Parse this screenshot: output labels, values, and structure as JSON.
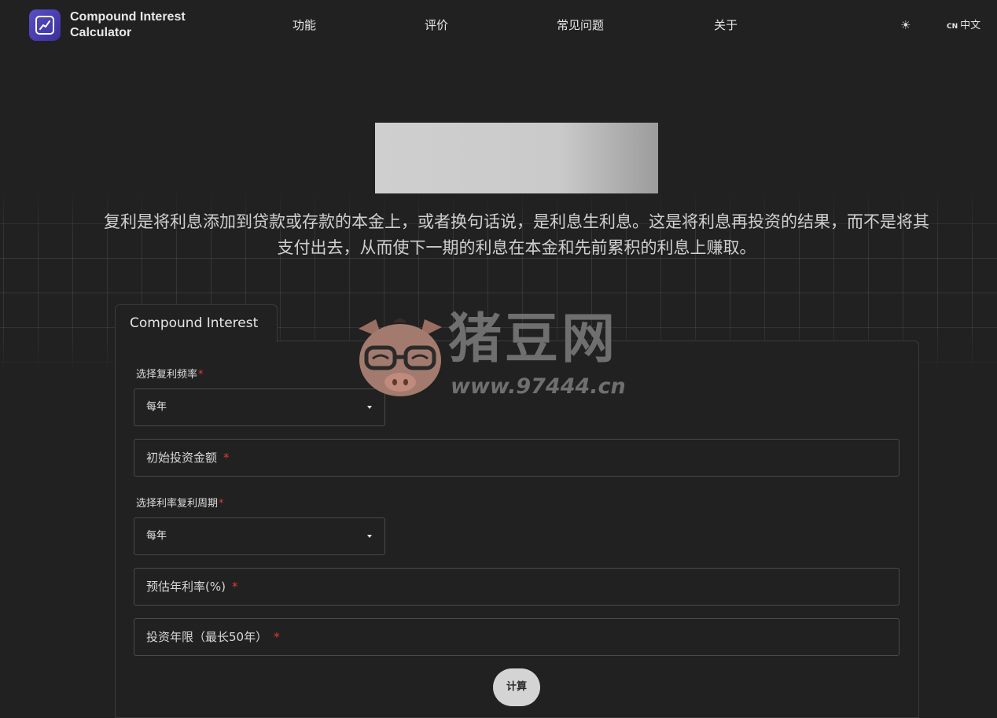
{
  "header": {
    "brand_line1": "Compound Interest",
    "brand_line2": "Calculator",
    "nav": [
      "功能",
      "评价",
      "常见问题",
      "关于"
    ],
    "theme_icon": "☀",
    "lang_flag": "CN",
    "lang_label": "中文"
  },
  "hero": {
    "description": "复利是将利息添加到贷款或存款的本金上，或者换句话说，是利息生利息。这是将利息再投资的结果，而不是将其支付出去，从而使下一期的利息在本金和先前累积的利息上赚取。"
  },
  "form": {
    "tab_label": "Compound Interest",
    "compound_frequency_label": "选择复利频率",
    "compound_frequency_value": "每年",
    "initial_investment_placeholder": "初始投资金额",
    "rate_period_label": "选择利率复利周期",
    "rate_period_value": "每年",
    "annual_rate_placeholder": "预估年利率(%)",
    "years_placeholder": "投资年限（最长50年）",
    "required_mark": "*",
    "calculate_label": "计算"
  },
  "watermark": {
    "title": "猪豆网",
    "url": "www.97444.cn"
  },
  "colors": {
    "background": "#212121",
    "logo": "#4b40b8",
    "required": "#e53935",
    "button": "#d4d4d4"
  }
}
